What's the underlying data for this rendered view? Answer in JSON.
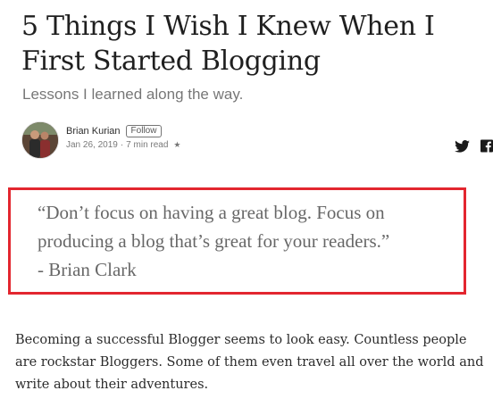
{
  "article": {
    "title": "5 Things I Wish I Knew When I First Started Blogging",
    "subtitle": "Lessons I learned along the way."
  },
  "author": {
    "name": "Brian Kurian",
    "follow_label": "Follow",
    "date": "Jan 26, 2019",
    "separator": "·",
    "read_time": "7 min read",
    "star": "★"
  },
  "social": {
    "icons": [
      "twitter-icon",
      "facebook-icon"
    ]
  },
  "quote": {
    "text": "“Don’t focus on having a great blog. Focus on producing a blog that’s great for your readers.”",
    "attribution": "- Brian Clark",
    "highlight_color": "#e3262f"
  },
  "body": {
    "paragraph": "Becoming a successful Blogger seems to look easy. Countless people are rockstar Bloggers. Some of them even travel all over the world and write about their adventures."
  }
}
